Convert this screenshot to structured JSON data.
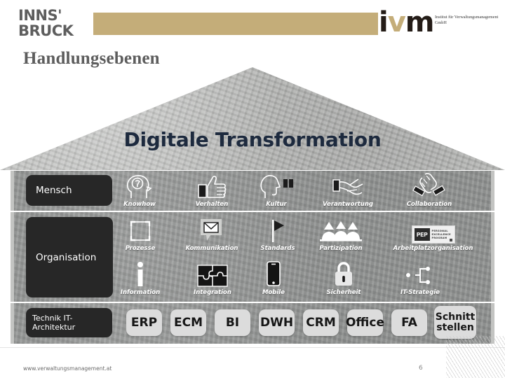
{
  "header": {
    "innsbruck_line1": "INNS'",
    "innsbruck_line2": "BRUCK",
    "ivm_mark_i": "i",
    "ivm_mark_v": "v",
    "ivm_mark_m": "m",
    "ivm_subtitle": "Institut für Verwaltungsmanagement GmbH",
    "band_color": "#c4ad79"
  },
  "page_title": "Handlungsebenen",
  "house": {
    "roof_title": "Digitale Transformation",
    "roof_title_color": "#1d2a3e",
    "levels": [
      {
        "id": "mensch",
        "label": "Mensch"
      },
      {
        "id": "organisation",
        "label": "Organisation"
      },
      {
        "id": "technik",
        "label": "Technik IT-Architektur"
      }
    ],
    "rows": [
      {
        "level": "Mensch",
        "cells": [
          {
            "caption": "Knowhow",
            "icon": "head-brain-icon"
          },
          {
            "caption": "Verhalten",
            "icon": "thumbs-up-icon"
          },
          {
            "caption": "Kultur",
            "icon": "head-quote-icon"
          },
          {
            "caption": "Verantwortung",
            "icon": "hand-signing-icon"
          },
          {
            "caption": "Collaboration",
            "icon": "handshake-icon"
          }
        ]
      },
      {
        "level": "Organisation-upper",
        "cells": [
          {
            "caption": "Prozesse",
            "icon": "process-square-icon"
          },
          {
            "caption": "Kommunikation",
            "icon": "mail-bubble-icon"
          },
          {
            "caption": "Standards",
            "icon": "flag-icon"
          },
          {
            "caption": "Partizipation",
            "icon": "people-group-icon"
          },
          {
            "caption": "Arbeitplatzorganisation",
            "icon": "pep-card-icon"
          }
        ]
      },
      {
        "level": "Organisation-lower",
        "cells": [
          {
            "caption": "Information",
            "icon": "info-i-icon"
          },
          {
            "caption": "Integration",
            "icon": "puzzle-icon"
          },
          {
            "caption": "Mobile",
            "icon": "smartphone-icon"
          },
          {
            "caption": "Sicherheit",
            "icon": "padlock-icon"
          },
          {
            "caption": "IT-Strategie",
            "icon": "network-path-icon"
          }
        ]
      }
    ],
    "pep_card": {
      "logo_text": "PEP",
      "line1": "PERSONAL",
      "line2": "EXCELLENCE",
      "line3": "PROGRAM"
    },
    "tech_tiles": [
      {
        "label": "ERP"
      },
      {
        "label": "ECM"
      },
      {
        "label": "BI"
      },
      {
        "label": "DWH"
      },
      {
        "label": "CRM"
      },
      {
        "label": "Office"
      },
      {
        "label": "FA"
      },
      {
        "label": "Schnitt\nstellen"
      }
    ]
  },
  "footer": {
    "url": "www.verwaltungsmanagement.at",
    "page_number": "6"
  }
}
